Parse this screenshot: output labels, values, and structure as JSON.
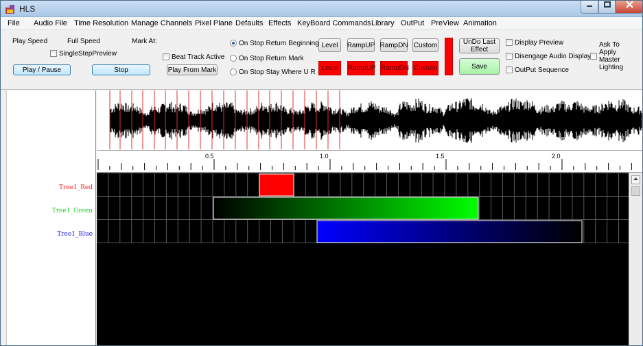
{
  "window": {
    "title": "HLS",
    "icon": "hls-app-icon"
  },
  "menu": [
    "File",
    "Audio File",
    "Time Resolution",
    "Manage Channels",
    "Pixel Plane",
    "Defaults",
    "Effects",
    "KeyBoard Commands",
    "Library",
    "OutPut",
    "PreView",
    "Animation"
  ],
  "toolbar": {
    "play_speed_label": "Play Speed",
    "full_speed_label": "Full Speed",
    "mark_at_label": "Mark At:",
    "single_step_label": "SingleStepPreview",
    "beat_track_label": "Beat Track Active",
    "play_pause_label": "Play / Pause",
    "stop_label": "Stop",
    "play_from_mark_label": "Play From Mark",
    "radios": [
      {
        "label": "On Stop Return Beginning",
        "selected": true
      },
      {
        "label": "On Stop Return Mark",
        "selected": false
      },
      {
        "label": "On Stop Stay Where U R",
        "selected": false
      }
    ],
    "effect_buttons": [
      "Level",
      "RampUP",
      "RampDN",
      "Custom"
    ],
    "effect_swatches": [
      "Level",
      "RampUP",
      "RampDN",
      "Custom"
    ],
    "swatch_color": "#ff0000",
    "undo_label": "UnDo Last Effect",
    "save_label": "Save",
    "display_preview_label": "Display Preview",
    "disengage_audio_label": "Disengage Audio Display",
    "output_sequence_label": "OutPut Sequence",
    "ask_master_label": "Ask To Apply Master Lighting"
  },
  "timeline": {
    "ruler_labels": [
      "0.5",
      "1.0",
      "1.5",
      "2.0"
    ],
    "marker_color": "#e03030"
  },
  "channels": [
    {
      "name": "Tree1_Red",
      "color": "#ff2020",
      "effect_color": "#ff0000"
    },
    {
      "name": "Tree1_Green",
      "color": "#20d020",
      "effect_color": "#00ff00"
    },
    {
      "name": "Tree1_Blue",
      "color": "#2020e0",
      "effect_color": "#0000ff"
    }
  ],
  "colors": {
    "grid_bg": "#000000",
    "grid_line": "#5a5a5a"
  }
}
